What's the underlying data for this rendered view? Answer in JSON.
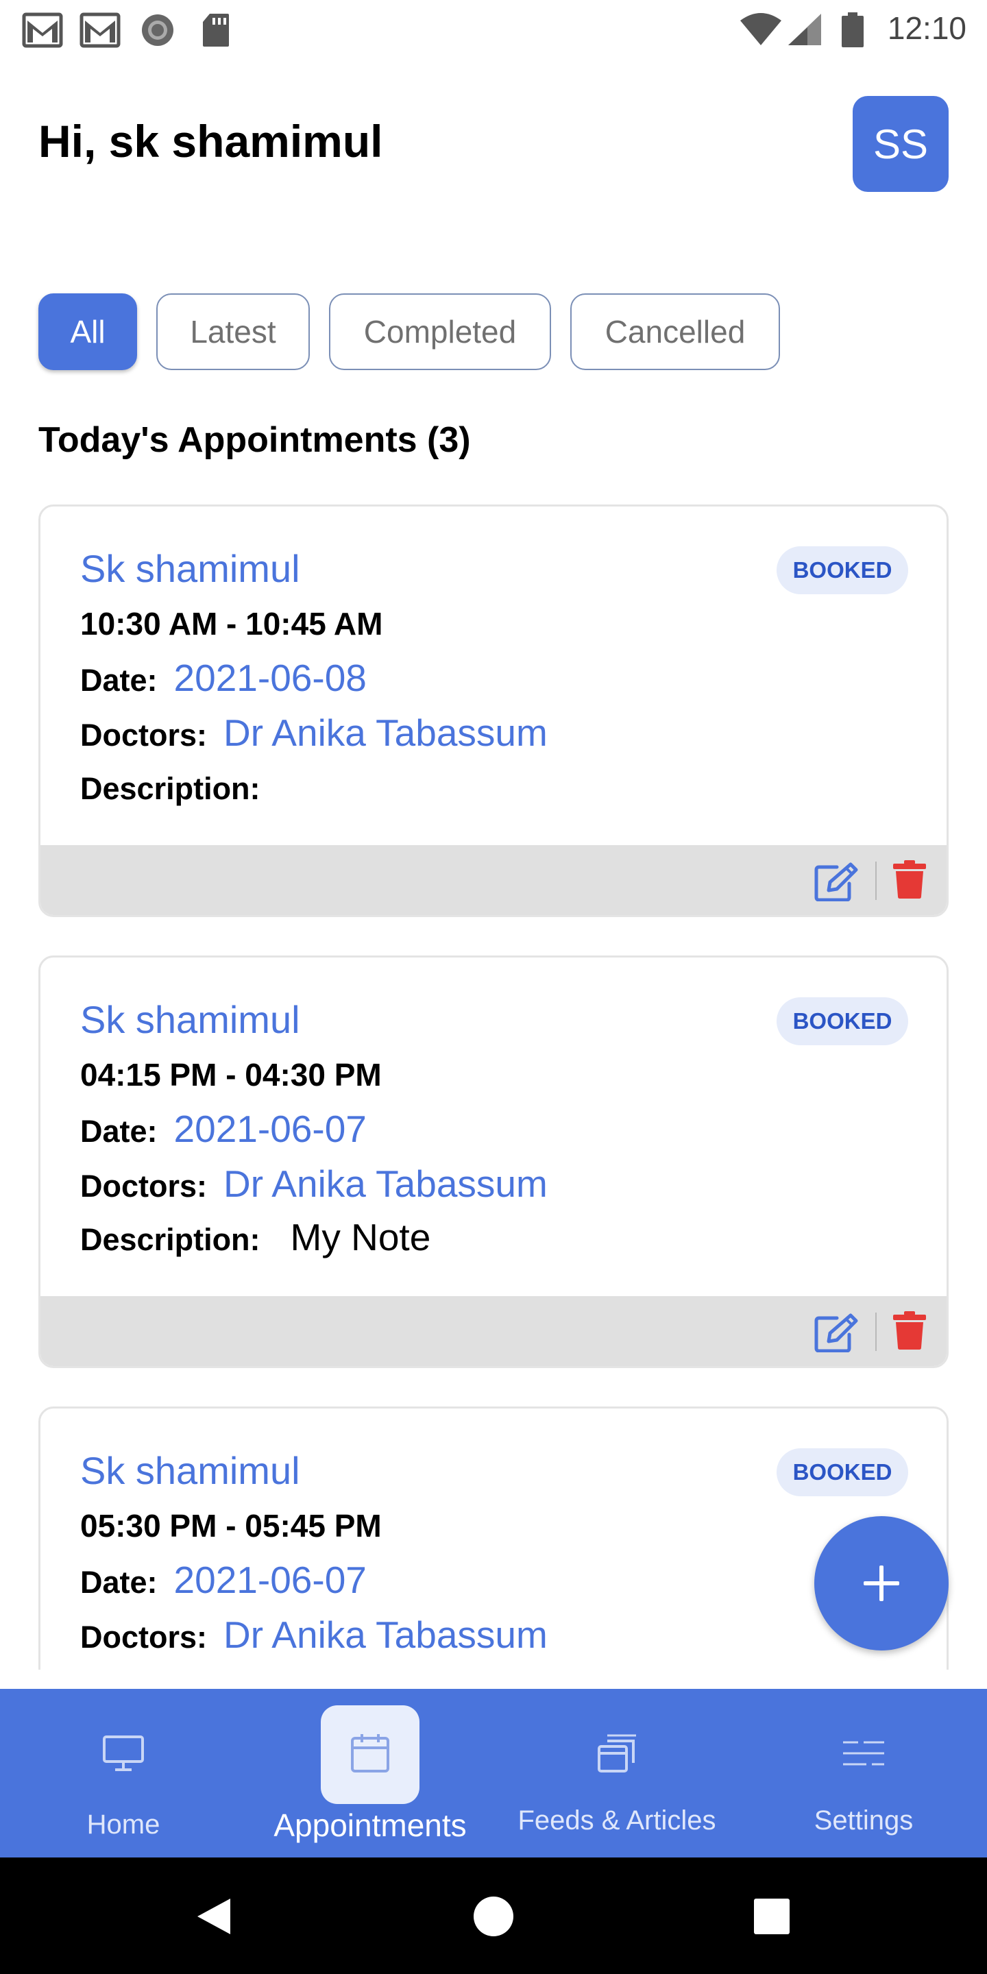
{
  "status_bar": {
    "time": "12:10",
    "icons": [
      "gmail-icon",
      "gmail-icon",
      "record-icon",
      "sd-card-icon",
      "wifi-icon",
      "signal-icon",
      "battery-icon"
    ]
  },
  "header": {
    "greeting": "Hi, sk shamimul",
    "avatar_initials": "SS"
  },
  "filters": {
    "chips": [
      "All",
      "Latest",
      "Completed",
      "Cancelled"
    ],
    "selected": "All"
  },
  "section": {
    "title": "Today's Appointments (3)"
  },
  "labels": {
    "date": "Date:",
    "doctors": "Doctors:",
    "description": "Description:"
  },
  "appointments": [
    {
      "name": "Sk shamimul",
      "status": "BOOKED",
      "time": "10:30 AM - 10:45 AM",
      "date": "2021-06-08",
      "doctor": "Dr Anika Tabassum",
      "description": ""
    },
    {
      "name": "Sk shamimul",
      "status": "BOOKED",
      "time": "04:15 PM - 04:30 PM",
      "date": "2021-06-07",
      "doctor": "Dr Anika Tabassum",
      "description": "My Note"
    },
    {
      "name": "Sk shamimul",
      "status": "BOOKED",
      "time": "05:30 PM - 05:45 PM",
      "date": "2021-06-07",
      "doctor": "Dr Anika Tabassum",
      "description": ""
    }
  ],
  "bottom_nav": {
    "items": [
      {
        "label": "Home",
        "icon": "monitor-icon"
      },
      {
        "label": "Appointments",
        "icon": "calendar-icon"
      },
      {
        "label": "Feeds & Articles",
        "icon": "articles-icon"
      },
      {
        "label": "Settings",
        "icon": "settings-icon"
      }
    ],
    "active": "Appointments"
  },
  "colors": {
    "primary": "#4a74dc",
    "delete": "#e53935",
    "badge_bg": "#e6ecfa"
  }
}
